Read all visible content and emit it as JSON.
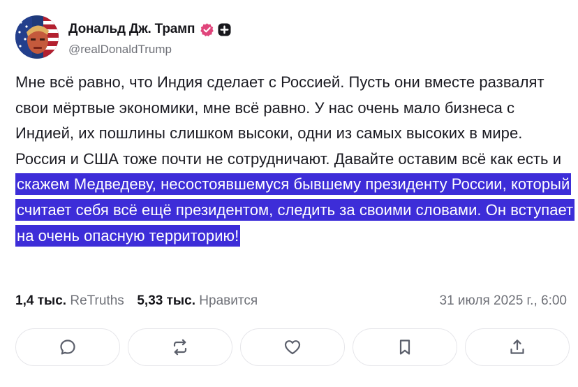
{
  "author": {
    "display_name": "Дональд Дж. Трамп",
    "handle": "@realDonaldTrump"
  },
  "post": {
    "text_plain": "Мне всё равно, что Индия сделает с Россией. Пусть они вместе развалят свои мёртвые экономики, мне всё равно. У нас очень мало бизнеса с Индией, их пошлины слишком высоки, одни из самых высоких в мире. Россия и США тоже почти не сотрудничают. Давайте оставим всё как есть и ",
    "text_highlighted": "скажем Медведеву, несостоявшемуся бывшему президенту России, который считает себя всё ещё президентом, следить за своими словами. Он вступает на очень опасную территорию!"
  },
  "stats": {
    "retruths_count": "1,4 тыс.",
    "retruths_label": "ReTruths",
    "likes_count": "5,33 тыс.",
    "likes_label": "Нравится",
    "date": "31 июля 2025 г., 6:00"
  },
  "actions": [
    "reply-icon",
    "retruth-icon",
    "like-icon",
    "bookmark-icon",
    "share-icon"
  ],
  "colors": {
    "highlight": "#3d2dd8",
    "verified_badge": "#e0457b",
    "muted_text": "#6f7178",
    "button_border": "#e6e6ea"
  }
}
